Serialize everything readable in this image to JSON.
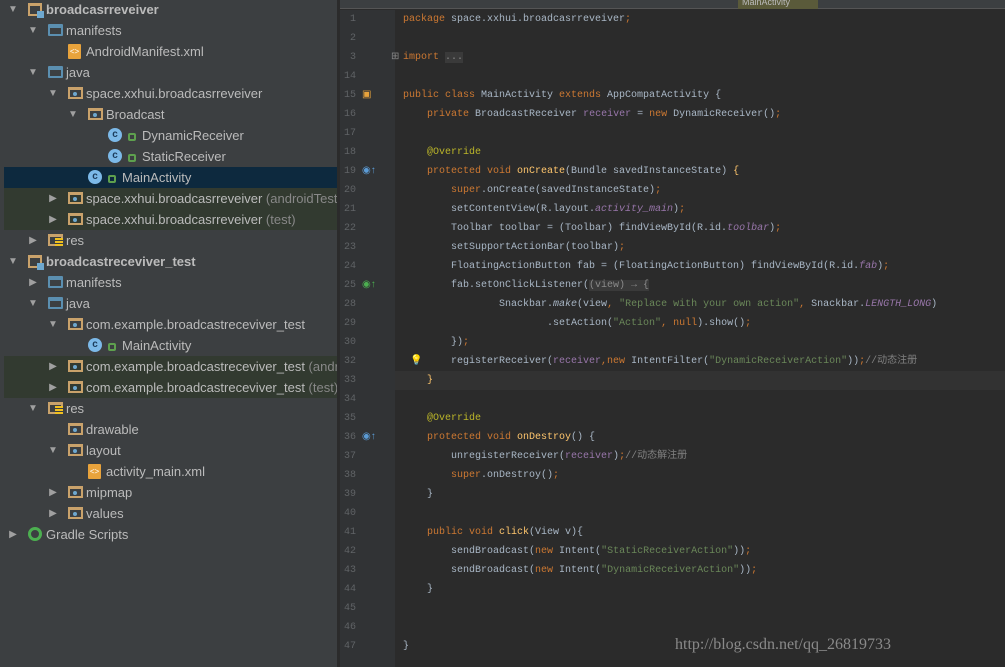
{
  "editor_tab": "MainActivity",
  "tree": [
    {
      "label": "broadcasrreveiver",
      "depth": 0,
      "arrow": "expanded",
      "icon": "module",
      "bold": true
    },
    {
      "label": "manifests",
      "depth": 1,
      "arrow": "expanded",
      "icon": "folder"
    },
    {
      "label": "AndroidManifest.xml",
      "depth": 2,
      "arrow": "none",
      "icon": "xml-file"
    },
    {
      "label": "java",
      "depth": 1,
      "arrow": "expanded",
      "icon": "folder"
    },
    {
      "label": "space.xxhui.broadcasrreveiver",
      "depth": 2,
      "arrow": "expanded",
      "icon": "package"
    },
    {
      "label": "Broadcast",
      "depth": 3,
      "arrow": "expanded",
      "icon": "package"
    },
    {
      "label": "DynamicReceiver",
      "depth": 4,
      "arrow": "none",
      "icon": "class"
    },
    {
      "label": "StaticReceiver",
      "depth": 4,
      "arrow": "none",
      "icon": "class"
    },
    {
      "label": "MainActivity",
      "depth": 3,
      "arrow": "none",
      "icon": "class",
      "selected": true
    },
    {
      "label": "space.xxhui.broadcasrreveiver",
      "suffix": " (androidTest)",
      "depth": 2,
      "arrow": "collapsed",
      "icon": "package",
      "test": true
    },
    {
      "label": "space.xxhui.broadcasrreveiver",
      "suffix": " (test)",
      "depth": 2,
      "arrow": "collapsed",
      "icon": "package",
      "test": true
    },
    {
      "label": "res",
      "depth": 1,
      "arrow": "collapsed",
      "icon": "res"
    },
    {
      "label": "broadcastreceviver_test",
      "depth": 0,
      "arrow": "expanded",
      "icon": "module",
      "bold": true
    },
    {
      "label": "manifests",
      "depth": 1,
      "arrow": "collapsed",
      "icon": "folder"
    },
    {
      "label": "java",
      "depth": 1,
      "arrow": "expanded",
      "icon": "folder"
    },
    {
      "label": "com.example.broadcastreceviver_test",
      "depth": 2,
      "arrow": "expanded",
      "icon": "package"
    },
    {
      "label": "MainActivity",
      "depth": 3,
      "arrow": "none",
      "icon": "class"
    },
    {
      "label": "com.example.broadcastreceviver_test",
      "suffix": " (androidTest)",
      "depth": 2,
      "arrow": "collapsed",
      "icon": "package",
      "test": true
    },
    {
      "label": "com.example.broadcastreceviver_test",
      "suffix": " (test)",
      "depth": 2,
      "arrow": "collapsed",
      "icon": "package",
      "test": true
    },
    {
      "label": "res",
      "depth": 1,
      "arrow": "expanded",
      "icon": "res"
    },
    {
      "label": "drawable",
      "depth": 2,
      "arrow": "none",
      "icon": "package"
    },
    {
      "label": "layout",
      "depth": 2,
      "arrow": "expanded",
      "icon": "package"
    },
    {
      "label": "activity_main.xml",
      "depth": 3,
      "arrow": "none",
      "icon": "xml-file"
    },
    {
      "label": "mipmap",
      "depth": 2,
      "arrow": "collapsed",
      "icon": "package"
    },
    {
      "label": "values",
      "depth": 2,
      "arrow": "collapsed",
      "icon": "package"
    },
    {
      "label": "Gradle Scripts",
      "depth": 0,
      "arrow": "collapsed",
      "icon": "gradle"
    }
  ],
  "code": [
    {
      "n": "1",
      "tk": [
        [
          "package",
          "k"
        ],
        [
          " space.xxhui.broadcasrreveiver",
          "t"
        ],
        [
          ";",
          "k"
        ]
      ]
    },
    {
      "n": "2",
      "tk": []
    },
    {
      "n": "3",
      "tk": [
        [
          "import ",
          "k"
        ],
        [
          "...",
          "f"
        ]
      ],
      "gutter": "fold-plus"
    },
    {
      "n": "14",
      "tk": []
    },
    {
      "n": "15",
      "tk": [
        [
          "public class ",
          "k"
        ],
        [
          "MainActivity ",
          "t"
        ],
        [
          "extends ",
          "k"
        ],
        [
          "AppCompatActivity {",
          "t"
        ]
      ],
      "gutter": "android-icon"
    },
    {
      "n": "16",
      "tk": [
        [
          "    ",
          "t"
        ],
        [
          "private ",
          "k"
        ],
        [
          "BroadcastReceiver ",
          "t"
        ],
        [
          "receiver",
          "p"
        ],
        [
          " = ",
          "t"
        ],
        [
          "new ",
          "k"
        ],
        [
          "DynamicReceiver()",
          "t"
        ],
        [
          ";",
          "k"
        ]
      ]
    },
    {
      "n": "17",
      "tk": []
    },
    {
      "n": "18",
      "tk": [
        [
          "    @Override",
          "a"
        ]
      ]
    },
    {
      "n": "19",
      "tk": [
        [
          "    ",
          "t"
        ],
        [
          "protected void ",
          "k"
        ],
        [
          "onCreate",
          "m"
        ],
        [
          "(Bundle savedInstanceState) ",
          "t"
        ],
        [
          "{",
          "m"
        ]
      ],
      "gutter": "override-icon"
    },
    {
      "n": "20",
      "tk": [
        [
          "        ",
          "t"
        ],
        [
          "super",
          "k"
        ],
        [
          ".onCreate(savedInstanceState)",
          "t"
        ],
        [
          ";",
          "k"
        ]
      ]
    },
    {
      "n": "21",
      "tk": [
        [
          "        setContentView(R.layout.",
          "t"
        ],
        [
          "activity_main",
          "i"
        ],
        [
          ")",
          "t"
        ],
        [
          ";",
          "k"
        ]
      ]
    },
    {
      "n": "22",
      "tk": [
        [
          "        Toolbar toolbar = (Toolbar) findViewById(R.id.",
          "t"
        ],
        [
          "toolbar",
          "i"
        ],
        [
          ")",
          "t"
        ],
        [
          ";",
          "k"
        ]
      ]
    },
    {
      "n": "23",
      "tk": [
        [
          "        setSupportActionBar(toolbar)",
          "t"
        ],
        [
          ";",
          "k"
        ]
      ]
    },
    {
      "n": "24",
      "tk": [
        [
          "        FloatingActionButton fab = (FloatingActionButton) findViewById(R.id.",
          "t"
        ],
        [
          "fab",
          "i"
        ],
        [
          ")",
          "t"
        ],
        [
          ";",
          "k"
        ]
      ]
    },
    {
      "n": "25",
      "tk": [
        [
          "        fab.setOnClickListener(",
          "t"
        ],
        [
          "(view) → {",
          "f"
        ]
      ],
      "gutter": "lambda-icon"
    },
    {
      "n": "28",
      "tk": [
        [
          "                Snackbar.",
          "t"
        ],
        [
          "make",
          "it"
        ],
        [
          "(view",
          "t"
        ],
        [
          ", ",
          "k"
        ],
        [
          "\"Replace with your own action\"",
          "s"
        ],
        [
          ", ",
          "k"
        ],
        [
          "Snackbar.",
          "t"
        ],
        [
          "LENGTH_LONG",
          "i"
        ],
        [
          ")",
          "t"
        ]
      ]
    },
    {
      "n": "29",
      "tk": [
        [
          "                        .setAction(",
          "t"
        ],
        [
          "\"Action\"",
          "s"
        ],
        [
          ", null",
          "k"
        ],
        [
          ").show()",
          "t"
        ],
        [
          ";",
          "k"
        ]
      ]
    },
    {
      "n": "30",
      "tk": [
        [
          "        })",
          "t"
        ],
        [
          ";",
          "k"
        ]
      ]
    },
    {
      "n": "32",
      "tk": [
        [
          "        registerReceiver(",
          "t"
        ],
        [
          "receiver",
          "p"
        ],
        [
          ",new ",
          "k"
        ],
        [
          "IntentFilter(",
          "t"
        ],
        [
          "\"DynamicReceiverAction\"",
          "s"
        ],
        [
          "))",
          "t"
        ],
        [
          ";",
          "k"
        ],
        [
          "//动态注册",
          "c"
        ]
      ],
      "gutter": "bulb-icon"
    },
    {
      "n": "33",
      "tk": [
        [
          "    }",
          "m"
        ]
      ],
      "current": true
    },
    {
      "n": "34",
      "tk": []
    },
    {
      "n": "35",
      "tk": [
        [
          "    @Override",
          "a"
        ]
      ]
    },
    {
      "n": "36",
      "tk": [
        [
          "    ",
          "t"
        ],
        [
          "protected void ",
          "k"
        ],
        [
          "onDestroy",
          "m"
        ],
        [
          "() {",
          "t"
        ]
      ],
      "gutter": "override-icon"
    },
    {
      "n": "37",
      "tk": [
        [
          "        unregisterReceiver(",
          "t"
        ],
        [
          "receiver",
          "p"
        ],
        [
          ")",
          "t"
        ],
        [
          ";",
          "k"
        ],
        [
          "//动态解注册",
          "c"
        ]
      ]
    },
    {
      "n": "38",
      "tk": [
        [
          "        ",
          "t"
        ],
        [
          "super",
          "k"
        ],
        [
          ".onDestroy()",
          "t"
        ],
        [
          ";",
          "k"
        ]
      ]
    },
    {
      "n": "39",
      "tk": [
        [
          "    }",
          "t"
        ]
      ]
    },
    {
      "n": "40",
      "tk": []
    },
    {
      "n": "41",
      "tk": [
        [
          "    ",
          "t"
        ],
        [
          "public void ",
          "k"
        ],
        [
          "click",
          "m"
        ],
        [
          "(View v){",
          "t"
        ]
      ]
    },
    {
      "n": "42",
      "tk": [
        [
          "        sendBroadcast(",
          "t"
        ],
        [
          "new ",
          "k"
        ],
        [
          "Intent(",
          "t"
        ],
        [
          "\"StaticReceiverAction\"",
          "s"
        ],
        [
          "))",
          "t"
        ],
        [
          ";",
          "k"
        ]
      ]
    },
    {
      "n": "43",
      "tk": [
        [
          "        sendBroadcast(",
          "t"
        ],
        [
          "new ",
          "k"
        ],
        [
          "Intent(",
          "t"
        ],
        [
          "\"DynamicReceiverAction\"",
          "s"
        ],
        [
          "))",
          "t"
        ],
        [
          ";",
          "k"
        ]
      ]
    },
    {
      "n": "44",
      "tk": [
        [
          "    }",
          "t"
        ]
      ]
    },
    {
      "n": "45",
      "tk": []
    },
    {
      "n": "46",
      "tk": []
    },
    {
      "n": "47",
      "tk": [
        [
          "}",
          "t"
        ]
      ]
    }
  ],
  "watermark": "http://blog.csdn.net/qq_26819733",
  "colors": {
    "keyword": "#cc7832",
    "field": "#9876aa",
    "string": "#6a8759",
    "annotation": "#bbb529",
    "method": "#ffc66d",
    "text": "#a9b7c6",
    "selection": "#0d293e"
  }
}
